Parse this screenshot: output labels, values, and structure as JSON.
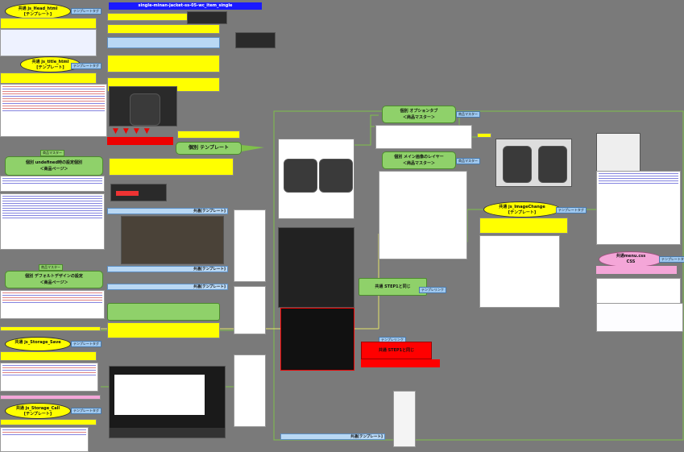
{
  "page": {
    "title": "single-minan-jacket-ss-05-wc_item_single"
  },
  "nodes": {
    "head_html": {
      "prefix": "共通",
      "name": "js_Head_html",
      "kind": "[テンプレート]"
    },
    "title_html": {
      "prefix": "共通",
      "name": "js_title_html",
      "kind": "[テンプレート]"
    },
    "undefined_setting": {
      "title": "個別 undefined時の設定個別",
      "sub": "＜商品ページ＞"
    },
    "default_design": {
      "title": "個別 デフォルトデザインの設定",
      "sub": "＜商品ページ＞"
    },
    "storage_save": {
      "prefix": "共通",
      "name": "js_Storage_Save",
      "kind": ""
    },
    "storage_call": {
      "prefix": "共通",
      "name": "js_Storage_Call",
      "kind": "[テンプレート]"
    },
    "individual_template": {
      "label": "個別 テンプレート"
    },
    "option_tab": {
      "title": "個別 オプションタブ",
      "sub": "＜商品マスター＞"
    },
    "main_image_layer": {
      "title": "個別 メイン画像のレイヤー",
      "sub": "＜商品マスター＞"
    },
    "image_change": {
      "prefix": "共通",
      "name": "js_ImageChange",
      "kind": "[テンプレート]"
    },
    "menu_css": {
      "prefix": "共通menu.css",
      "name": "CSS"
    },
    "steps_same_1": {
      "label": "共通 STEP1と同じ"
    },
    "steps_same_2": {
      "label": "共通 STEP1と同じ"
    },
    "common_template_1": {
      "label": "共通[テンプレート]"
    },
    "common_template_2": {
      "label": "共通[テンプレート]"
    },
    "common_template_3": {
      "label": "共通[テンプレート]"
    },
    "common_template_4": {
      "label": "共通[テンプレート]"
    }
  },
  "tags": {
    "template_tag": "テンプレートタグ",
    "product_master": "商品マスター",
    "template_link": "テンプレリンク"
  },
  "colors": {
    "background": "#7a7a7a",
    "oval": "#ffff00",
    "green": "#8fd16a",
    "blue": "#b9d8f4",
    "red": "#ff0000",
    "pink": "#f4a6d8",
    "connector": "#7fc04a"
  }
}
